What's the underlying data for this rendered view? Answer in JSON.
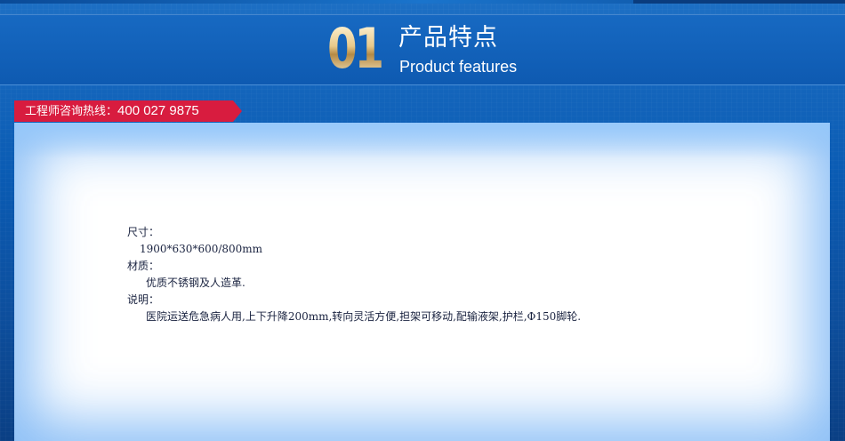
{
  "header": {
    "number": "01",
    "title_cn": "产品特点",
    "title_en": "Product features"
  },
  "hotline": {
    "label": "工程师咨询热线：",
    "number": "400 027 9875"
  },
  "specs": {
    "size_label": "尺寸：",
    "size_value": "1900*630*600/800mm",
    "material_label": "材质：",
    "material_value": "优质不锈钢及人造革.",
    "desc_label": "说明：",
    "desc_value": "医院运送危急病人用,上下升降200mm,转向灵活方便,担架可移动,配输液架,护栏,Φ150脚轮."
  },
  "colors": {
    "background_blue": "#0a5bb3",
    "hotline_red": "#d81c3f",
    "text": "#1a2340"
  }
}
